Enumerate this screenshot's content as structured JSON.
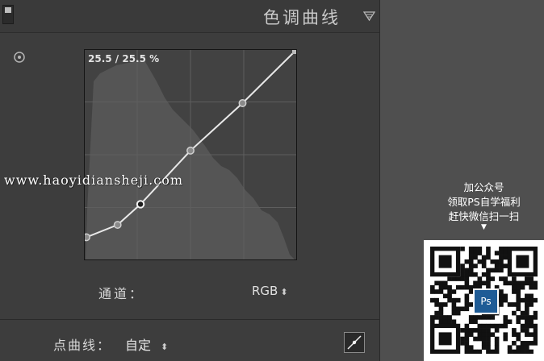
{
  "panel": {
    "title": "色调曲线",
    "icons": {
      "grip": "panel-grip-icon",
      "collapse": "collapse-triangle-icon",
      "target": "target-adjust-icon",
      "edit": "edit-point-curve-icon"
    },
    "readout": "25.5 / 25.5 %",
    "channel_label": "通道：",
    "channel_value": "RGB",
    "point_curve_label": "点曲线：",
    "point_curve_value": "自定",
    "updown_glyph": "⬍"
  },
  "curve": {
    "points": [
      [
        0,
        10
      ],
      [
        15,
        16
      ],
      [
        26,
        26
      ],
      [
        50,
        52
      ],
      [
        75,
        75
      ],
      [
        100,
        100
      ]
    ],
    "selected_point_index": 2,
    "grid_divisions": 4,
    "colors": {
      "curve": "#e8e8e8",
      "grid": "#5e5e5e",
      "histogram": "#555555",
      "background": "#424242"
    }
  },
  "watermark": "www.haoyidiansheji.com",
  "promo": {
    "lines": [
      "加公众号",
      "领取PS自学福利",
      "赶快微信扫一扫"
    ],
    "arrow": "▼",
    "badge": "Ps"
  }
}
